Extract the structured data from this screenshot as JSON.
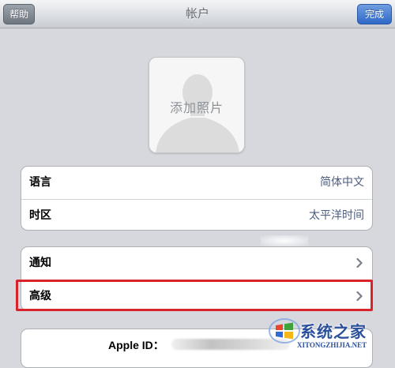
{
  "navbar": {
    "help_label": "帮助",
    "title": "帐户",
    "done_label": "完成"
  },
  "photo": {
    "label": "添加照片"
  },
  "group1": {
    "rows": [
      {
        "label": "语言",
        "value": "简体中文"
      },
      {
        "label": "时区",
        "value": "太平洋时间"
      }
    ]
  },
  "group2": {
    "rows": [
      {
        "label": "通知"
      },
      {
        "label": "高级"
      }
    ]
  },
  "group3": {
    "apple_id_label": "Apple ID："
  },
  "watermark": {
    "title": "系统之家",
    "url": "XITONGZHIJIA.NET"
  },
  "colors": {
    "highlight": "#d8232a",
    "done_button": "#2f68c8",
    "value_text": "#4b5e80"
  },
  "icons": {
    "photo_placeholder": "person-silhouette-icon",
    "row_chevron": "chevron-right-icon",
    "watermark_logo": "windows-logo-icon"
  }
}
